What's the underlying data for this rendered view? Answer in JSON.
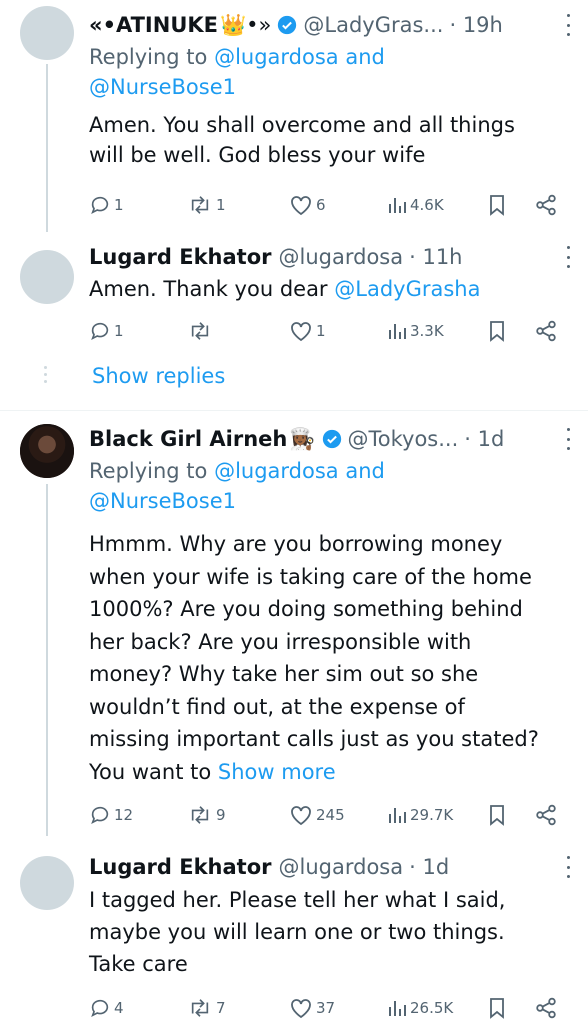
{
  "tweets": [
    {
      "name": "«•ATINUKE",
      "name_suffix": "👑•»",
      "handle": "@LadyGras...",
      "time": "· 19h",
      "reply_prefix": "Replying to ",
      "reply_user1": "@lugardosa",
      "reply_and": " and",
      "reply_user2": "@NurseBose1",
      "text": "Amen. You shall overcome and all things will be well. God bless your wife",
      "replies": "1",
      "retweets": "1",
      "likes": "6",
      "views": "4.6K"
    },
    {
      "name": "Lugard Ekhator",
      "handle": "@lugardosa",
      "time": "· 11h",
      "text_prefix": "Amen. Thank you dear ",
      "text_mention": "@LadyGrasha",
      "replies": "1",
      "retweets": "",
      "likes": "1",
      "views": "3.3K"
    },
    {
      "name": "Black Girl Airneh",
      "name_suffix": "👩🏾‍🍳",
      "handle": "@Tokyos...",
      "time": "· 1d",
      "reply_prefix": "Replying to ",
      "reply_user1": "@lugardosa",
      "reply_and": " and",
      "reply_user2": "@NurseBose1",
      "text": "Hmmm. Why are you borrowing money when your wife is taking care of the home 1000%? Are you doing something behind her back? Are you irresponsible with money? Why take her sim out so she wouldn’t find out, at the expense of missing important calls just as you stated? You want to ",
      "show_more": "Show more",
      "replies": "12",
      "retweets": "9",
      "likes": "245",
      "views": "29.7K"
    },
    {
      "name": "Lugard Ekhator",
      "handle": "@lugardosa",
      "time": "· 1d",
      "text": "I tagged her. Please tell her what I said, maybe you will learn one or two things. Take care",
      "replies": "4",
      "retweets": "7",
      "likes": "37",
      "views": "26.5K"
    }
  ],
  "show_replies_label": "Show replies",
  "colors": {
    "link": "#1d9bf0",
    "muted": "#536471",
    "text": "#0f1419",
    "verified": "#1d9bf0",
    "avatar_placeholder": "#cfd9de"
  },
  "icons": [
    "reply-icon",
    "retweet-icon",
    "like-icon",
    "views-icon",
    "bookmark-icon",
    "share-icon",
    "verified-badge-icon",
    "more-options-icon"
  ]
}
